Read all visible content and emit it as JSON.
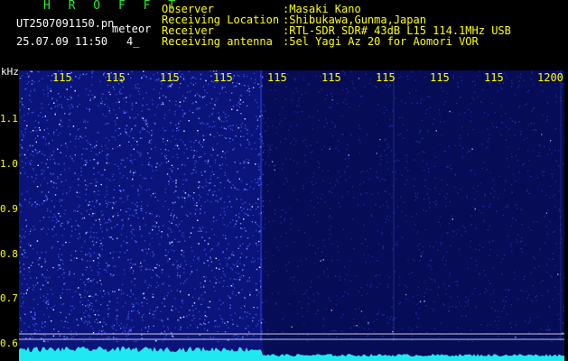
{
  "header": {
    "title": "H R O F F T",
    "file_name": "UT2507091150.pn",
    "tag": "meteor",
    "datetime": "25.07.09 11:50",
    "count": "4_"
  },
  "info": {
    "observer_label": "Observer",
    "observer_value": ":Masaki Kano",
    "location_label": "Receiving Location",
    "location_value": ":Shibukawa,Gunma,Japan",
    "receiver_label": "Receiver",
    "receiver_value": ":RTL-SDR SDR# 43dB L15 114.1MHz USB",
    "antenna_label": "Receiving antenna",
    "antenna_value": ":5el Yagi Az 20 for Aomori VOR"
  },
  "axes": {
    "y_unit": "kHz",
    "y_ticks": [
      "1.1",
      "1.0",
      "0.9",
      "0.8",
      "0.7",
      "0.6"
    ],
    "x_ticks": [
      "115",
      "115",
      "115",
      "115",
      "115",
      "115",
      "115",
      "115",
      "115",
      "1200"
    ]
  },
  "colors": {
    "background": "#000000",
    "header_text": "#ffff00",
    "title_text": "#2ee82e",
    "waterfall_base": "#0a147a",
    "signal_trace": "#20e8f0"
  }
}
